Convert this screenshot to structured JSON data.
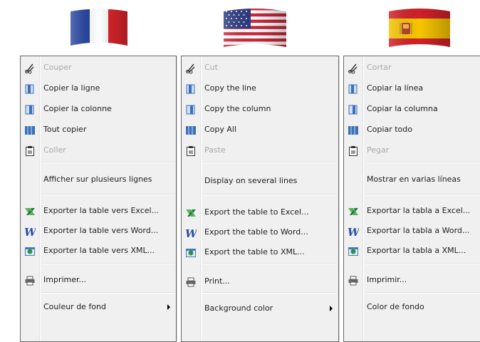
{
  "languages": [
    {
      "id": "fr",
      "flag": "france-flag",
      "items": {
        "cut": "Couper",
        "copy_line": "Copier la ligne",
        "copy_column": "Copier la colonne",
        "copy_all": "Tout copier",
        "paste": "Coller",
        "multi_line": "Afficher sur plusieurs lignes",
        "export_excel": "Exporter la table vers Excel...",
        "export_word": "Exporter la table vers Word...",
        "export_xml": "Exporter la table vers XML...",
        "print": "Imprimer...",
        "background": "Couleur de fond"
      }
    },
    {
      "id": "en",
      "flag": "usa-flag",
      "items": {
        "cut": "Cut",
        "copy_line": "Copy the line",
        "copy_column": "Copy the column",
        "copy_all": "Copy All",
        "paste": "Paste",
        "multi_line": "Display on several lines",
        "export_excel": "Export the table to Excel...",
        "export_word": "Export the table to Word...",
        "export_xml": "Export the table to XML...",
        "print": "Print...",
        "background": "Background color"
      }
    },
    {
      "id": "es",
      "flag": "spain-flag",
      "items": {
        "cut": "Cortar",
        "copy_line": "Copiar la línea",
        "copy_column": "Copiar la columna",
        "copy_all": "Copiar todo",
        "paste": "Pegar",
        "multi_line": "Mostrar en varias líneas",
        "export_excel": "Exportar la tabla a Excel...",
        "export_word": "Exportar la tabla a Word...",
        "export_xml": "Exportar la tabla a XML...",
        "print": "Imprimir...",
        "background": "Color de fondo"
      }
    }
  ],
  "disabled_items": [
    "cut",
    "paste"
  ],
  "colors": {
    "menu_background": "#f0f0f0",
    "menu_border": "#6a6a6a",
    "disabled_text": "#a8a8a8",
    "excel_green": "#1e7a3a",
    "word_blue": "#2b4fa8"
  }
}
